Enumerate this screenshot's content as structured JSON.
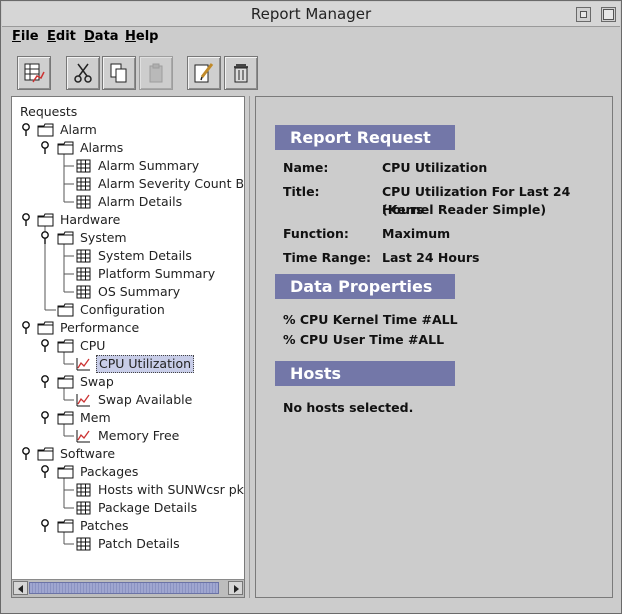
{
  "window": {
    "title": "Report Manager"
  },
  "menu": [
    {
      "label": "File",
      "mnemonic": "F",
      "rest": "ile"
    },
    {
      "label": "Edit",
      "mnemonic": "E",
      "rest": "dit"
    },
    {
      "label": "Data",
      "mnemonic": "D",
      "rest": "ata"
    },
    {
      "label": "Help",
      "mnemonic": "H",
      "rest": "elp"
    }
  ],
  "toolbar": [
    {
      "name": "new-report-icon",
      "enabled": true
    },
    {
      "name": "cut-icon",
      "enabled": true
    },
    {
      "name": "copy-icon",
      "enabled": true
    },
    {
      "name": "paste-icon",
      "enabled": false
    },
    {
      "name": "edit-icon",
      "enabled": true
    },
    {
      "name": "delete-icon",
      "enabled": true
    }
  ],
  "tree": {
    "root": "Requests",
    "nodes": [
      {
        "label": "Alarm",
        "level": 1,
        "type": "folder"
      },
      {
        "label": "Alarms",
        "level": 2,
        "type": "folder"
      },
      {
        "label": "Alarm Summary",
        "level": 3,
        "type": "table"
      },
      {
        "label": "Alarm Severity Count By Host",
        "level": 3,
        "type": "table"
      },
      {
        "label": "Alarm Details",
        "level": 3,
        "type": "table"
      },
      {
        "label": "Hardware",
        "level": 1,
        "type": "folder"
      },
      {
        "label": "System",
        "level": 2,
        "type": "folder"
      },
      {
        "label": "System Details",
        "level": 3,
        "type": "table"
      },
      {
        "label": "Platform Summary",
        "level": 3,
        "type": "table"
      },
      {
        "label": "OS Summary",
        "level": 3,
        "type": "table"
      },
      {
        "label": "Configuration",
        "level": 2,
        "type": "folder-leaf"
      },
      {
        "label": "Performance",
        "level": 1,
        "type": "folder"
      },
      {
        "label": "CPU",
        "level": 2,
        "type": "folder"
      },
      {
        "label": "CPU Utilization",
        "level": 3,
        "type": "chart",
        "selected": true
      },
      {
        "label": "Swap",
        "level": 2,
        "type": "folder"
      },
      {
        "label": "Swap Available",
        "level": 3,
        "type": "chart"
      },
      {
        "label": "Mem",
        "level": 2,
        "type": "folder"
      },
      {
        "label": "Memory Free",
        "level": 3,
        "type": "chart"
      },
      {
        "label": "Software",
        "level": 1,
        "type": "folder"
      },
      {
        "label": "Packages",
        "level": 2,
        "type": "folder"
      },
      {
        "label": "Hosts with SUNWcsr pkg",
        "level": 3,
        "type": "table"
      },
      {
        "label": "Package Details",
        "level": 3,
        "type": "table"
      },
      {
        "label": "Patches",
        "level": 2,
        "type": "folder"
      },
      {
        "label": "Patch Details",
        "level": 3,
        "type": "table"
      }
    ]
  },
  "details": {
    "report_request_header": "Report Request",
    "name_label": "Name:",
    "name_value": "CPU Utilization",
    "title_label": "Title:",
    "title_value_line1": "CPU Utilization For Last 24 Hours",
    "title_value_line2": "(Kernel Reader Simple)",
    "function_label": "Function:",
    "function_value": "Maximum",
    "time_range_label": "Time Range:",
    "time_range_value": "Last 24 Hours",
    "data_properties_header": "Data Properties",
    "properties": [
      "% CPU Kernel Time #ALL",
      "% CPU User Time #ALL"
    ],
    "hosts_header": "Hosts",
    "hosts_text": "No hosts selected."
  },
  "colors": {
    "section_header": "#7377a8",
    "selection": "#c8cde8",
    "scroll_thumb": "#9fa6d0"
  }
}
